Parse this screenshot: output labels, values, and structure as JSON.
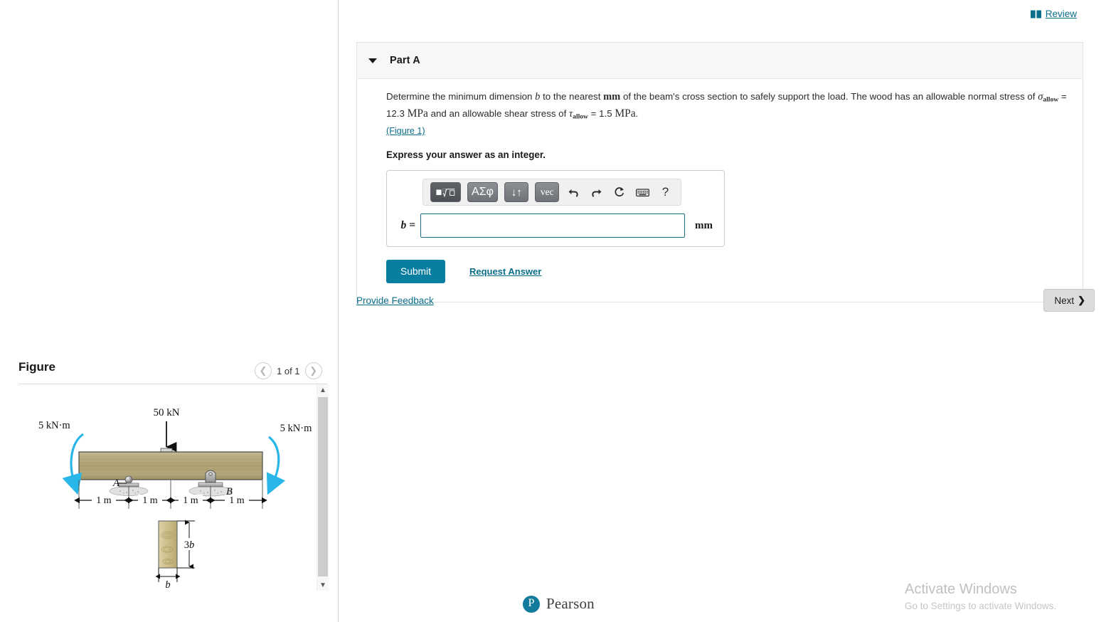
{
  "header": {
    "review_label": "Review",
    "book_icon": "book-icon"
  },
  "part": {
    "title": "Part A",
    "caret_icon": "caret-down-icon",
    "statement": {
      "seg1": "Determine the minimum dimension ",
      "var_b": "b",
      "seg2": " to the nearest ",
      "unit_mm": "mm",
      "seg3": " of the beam's cross section to safely support the load. The wood has an allowable normal stress of ",
      "sigma": "σ",
      "sigma_sub": "allow",
      "seg4": " = 12.3 ",
      "unit_mpa1": "MPa",
      "seg5": " and an allowable shear stress of ",
      "tau": "τ",
      "tau_sub": "allow",
      "seg6": " = 1.5 ",
      "unit_mpa2": "MPa",
      "seg7": "."
    },
    "figure_link": "(Figure 1)",
    "express": "Express your answer as an integer."
  },
  "answer": {
    "toolbar": {
      "template_button": "template-sqrt-button",
      "greek_button": "ΑΣφ",
      "arrows_button": "↓↑",
      "vec_button": "vec",
      "undo_icon": "undo-icon",
      "redo_icon": "redo-icon",
      "reset_icon": "reset-icon",
      "keyboard_icon": "keyboard-icon",
      "help_icon": "?"
    },
    "label": "b =",
    "value": "",
    "placeholder": "",
    "unit": "mm"
  },
  "actions": {
    "submit_label": "Submit",
    "request_answer_label": "Request Answer",
    "provide_feedback_label": "Provide Feedback",
    "next_label": "Next",
    "next_chevron": "❯"
  },
  "figure": {
    "title": "Figure",
    "nav": {
      "prev_icon": "chevron-left-icon",
      "next_icon": "chevron-right-icon",
      "count_label": "1 of 1"
    },
    "scrollbar": {
      "up_icon": "chevron-up-icon",
      "down_icon": "chevron-down-icon"
    },
    "diagram": {
      "point_load": "50 kN",
      "moment_left": "5 kN·m",
      "moment_right": "5 kN·m",
      "support_a": "A",
      "support_b": "B",
      "dim_1": "1 m",
      "dim_2": "1 m",
      "dim_3": "1 m",
      "dim_4": "1 m",
      "section_height": "3b",
      "section_width": "b"
    }
  },
  "footer": {
    "pearson_mark": "P",
    "pearson_word": "Pearson"
  },
  "watermark": {
    "title": "Activate Windows",
    "subtitle": "Go to Settings to activate Windows."
  },
  "colors": {
    "link": "#0a6e8a",
    "submit": "#0a7ea1",
    "beam_wood": "#b7ab7e",
    "moment_arrow": "#29b6e8",
    "pearson_teal": "#127a9b"
  }
}
